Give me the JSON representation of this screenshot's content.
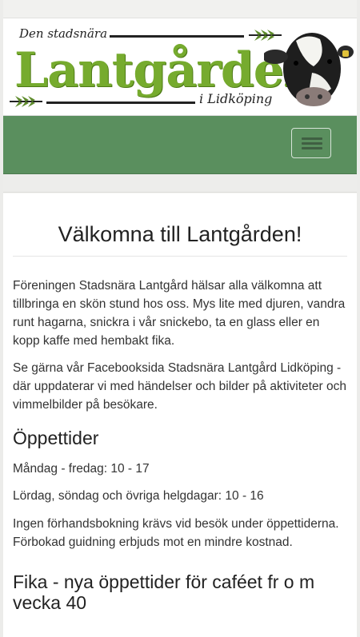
{
  "header": {
    "tagline_top": "Den stadsnära",
    "brand": "Lantgården",
    "tagline_bottom": "i Lidköping",
    "brand_color": "#76ab2e",
    "nav_color": "#5a8f5e",
    "menu_icon": "hamburger-menu-icon"
  },
  "main": {
    "title": "Välkomna till Lantgården!",
    "intro_1": "Föreningen Stadsnära Lantgård hälsar alla välkomna att tillbringa en skön stund hos oss. Mys lite med djuren, vandra runt hagarna, snickra i vår snickebo, ta en glass eller en kopp kaffe med hembakt fika.",
    "intro_2": "Se gärna vår Facebooksida Stadsnära Lantgård Lidköping - där uppdaterar vi med händelser och bilder på aktiviteter och vimmelbilder på besökare.",
    "opening_heading": "Öppettider",
    "weekdays": "Måndag - fredag: 10 - 17",
    "weekend": "Lördag, söndag och övriga helgdagar: 10 - 16",
    "booking_note": "Ingen förhandsbokning krävs vid besök under öppettiderna. Förbokad guidning erbjuds mot en mindre kostnad.",
    "cafe_heading": "Fika - nya öppettider för caféet fr o m vecka 40"
  }
}
